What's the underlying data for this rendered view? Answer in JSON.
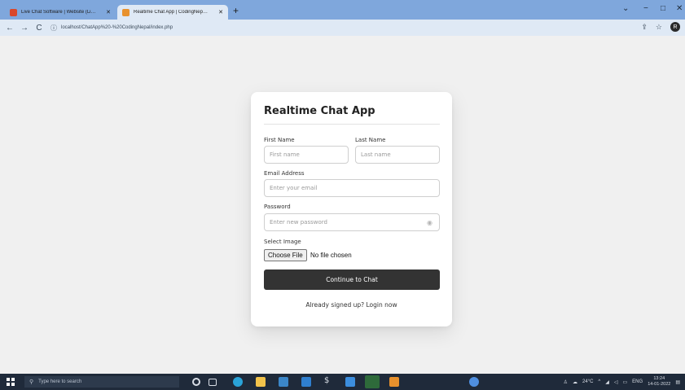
{
  "browser": {
    "tabs": [
      {
        "title": "Live Chat Software | Website (Li…",
        "icon_color": "#d9472b",
        "close": "✕"
      },
      {
        "title": "Realtime Chat App | CodingNep…",
        "icon_color": "#e8912d",
        "close": "✕"
      }
    ],
    "new_tab": "+",
    "window_controls": {
      "minimize": "−",
      "maximize": "□",
      "close": "✕",
      "dropdown": "⌄"
    },
    "nav": {
      "back": "←",
      "forward": "→",
      "reload": "C"
    },
    "address": {
      "url": "localhost/ChatApp%20-%20CodingNepal/index.php",
      "info_icon": "ⓘ"
    },
    "toolbar_right": {
      "share_icon": "⇪",
      "star_icon": "☆",
      "profile_initial": "R"
    }
  },
  "form": {
    "title": "Realtime Chat App",
    "first_name": {
      "label": "First Name",
      "placeholder": "First name"
    },
    "last_name": {
      "label": "Last Name",
      "placeholder": "Last name"
    },
    "email": {
      "label": "Email Address",
      "placeholder": "Enter your email"
    },
    "password": {
      "label": "Password",
      "placeholder": "Enter new password"
    },
    "image": {
      "label": "Select Image",
      "button": "Choose File",
      "status": "No file chosen"
    },
    "submit": "Continue to Chat",
    "login_prompt": "Already signed up?",
    "login_link": "Login now"
  },
  "taskbar": {
    "search_placeholder": "Type here to search",
    "weather": "24°C",
    "language": "ENG",
    "time": "13:24",
    "date": "14-01-2022"
  },
  "colors": {
    "tabstrip": "#7fa7dc",
    "toolbar": "#dfe9f5",
    "page_bg": "#f0f0f0",
    "button_dark": "#333333",
    "taskbar": "#1f2a3a"
  }
}
